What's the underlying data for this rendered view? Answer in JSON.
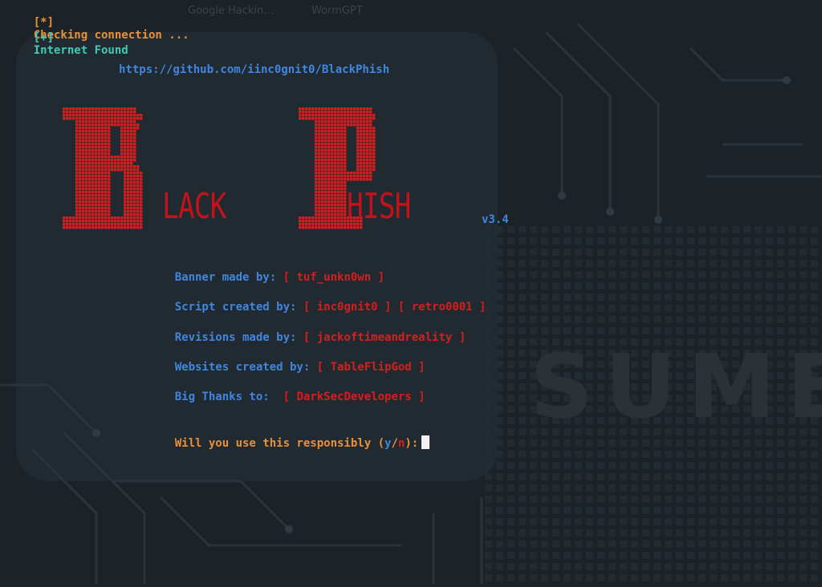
{
  "background": {
    "tab1": "Google Hackin…",
    "tab2": "WormGPT",
    "watermark": "SUME"
  },
  "status": {
    "line1_prefix": "[*]",
    "line1_text": "Checking connection ...",
    "line2_prefix": "[+]",
    "line2_text": "Internet Found"
  },
  "repo_url": "https://github.com/iinc0gnit0/BlackPhish",
  "logo": {
    "big_b": "B",
    "rest_b": "LACK",
    "big_p": "P",
    "rest_p": "HISH",
    "version": "v3.4"
  },
  "credits": [
    {
      "label": "Banner made by:",
      "values": [
        "[ tuf_unkn0wn ]"
      ]
    },
    {
      "label": "Script created by:",
      "values": [
        "[ inc0gnit0 ]",
        "[ retro0001 ]"
      ]
    },
    {
      "label": "Revisions made by:",
      "values": [
        "[ jackoftimeandreality ]"
      ]
    },
    {
      "label": "Websites created by:",
      "values": [
        "[ TableFlipGod ]"
      ]
    },
    {
      "label": "Big Thanks to: ",
      "values": [
        "[ DarkSecDevelopers ]"
      ]
    }
  ],
  "prompt": {
    "text": "Will you use this responsibly (",
    "yes": "y",
    "slash": "/",
    "no": "n",
    "suffix": "):"
  },
  "colors": {
    "background": "#1b2228",
    "orange": "#e8913a",
    "teal": "#41c9b4",
    "blue": "#3f86e0",
    "red": "#d51e1e"
  }
}
